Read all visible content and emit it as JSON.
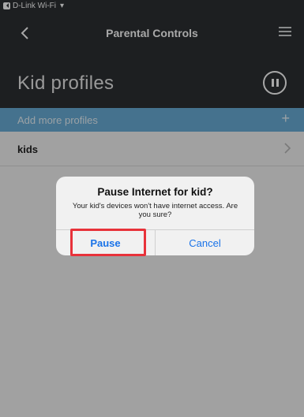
{
  "status": {
    "carrier": "D-Link Wi-Fi"
  },
  "nav": {
    "title": "Parental Controls"
  },
  "header": {
    "title": "Kid profiles"
  },
  "add_profiles": {
    "label": "Add more profiles",
    "plus": "+"
  },
  "profiles": [
    {
      "name": "kids"
    }
  ],
  "dialog": {
    "title": "Pause Internet for kid?",
    "message": "Your kid's devices won't have internet access. Are you sure?",
    "confirm_label": "Pause",
    "cancel_label": "Cancel"
  },
  "colors": {
    "header_bg": "#2c2f33",
    "accent_bar": "#6aaed8",
    "button_blue": "#1a73e8",
    "highlight": "#e8323a"
  }
}
